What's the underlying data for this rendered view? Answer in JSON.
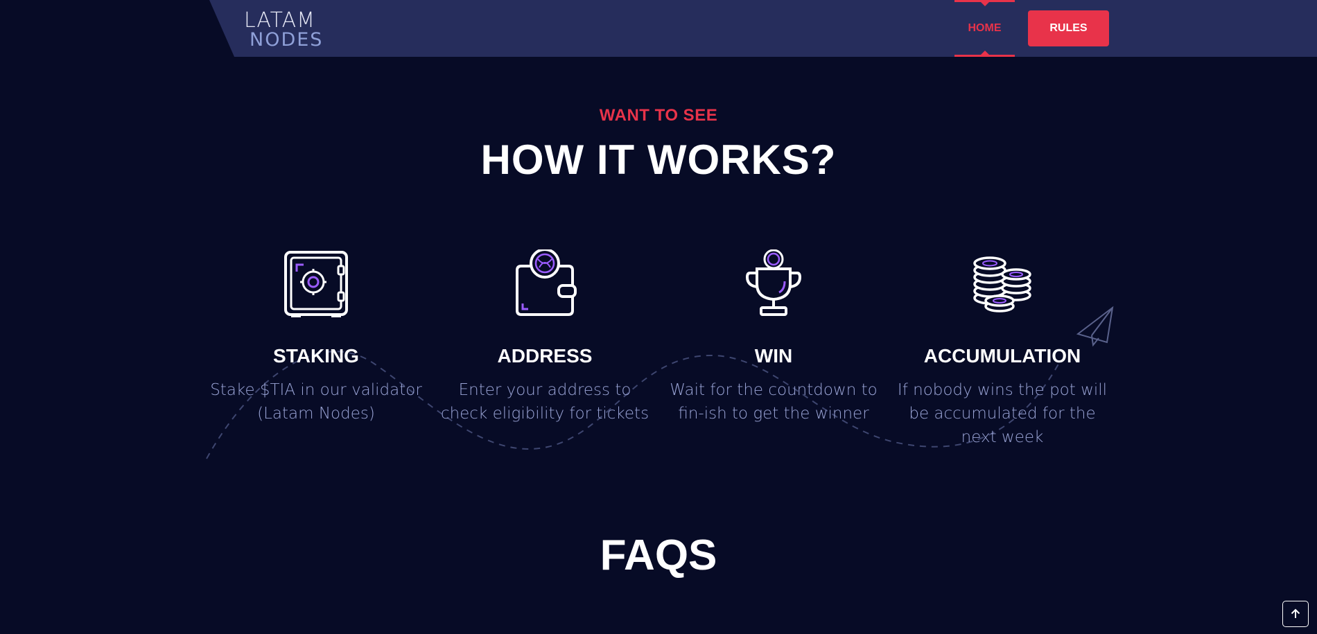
{
  "brand": {
    "logo_top": "LATAM",
    "logo_bottom": "NODES",
    "accent_color": "#e8334a",
    "background_color": "#070b26",
    "header_color": "#262d5c"
  },
  "nav": {
    "home_label": "HOME",
    "rules_label": "RULES"
  },
  "how_it_works": {
    "eyebrow": "WANT TO SEE",
    "title": "HOW IT WORKS?",
    "steps": [
      {
        "icon": "safe-icon",
        "title": "STAKING",
        "description": "Stake $TIA in our validator (Latam Nodes)"
      },
      {
        "icon": "wallet-icon",
        "title": "ADDRESS",
        "description": "Enter your address to check eligibility for tickets"
      },
      {
        "icon": "trophy-icon",
        "title": "WIN",
        "description": "Wait for the countdown to fin-ish to get the winner"
      },
      {
        "icon": "coins-icon",
        "title": "ACCUMULATION",
        "description": "If nobody wins the pot will be accumulated for the next week"
      }
    ]
  },
  "faqs": {
    "title": "FAQS"
  },
  "back_to_top": {
    "icon": "arrow-up-icon"
  }
}
